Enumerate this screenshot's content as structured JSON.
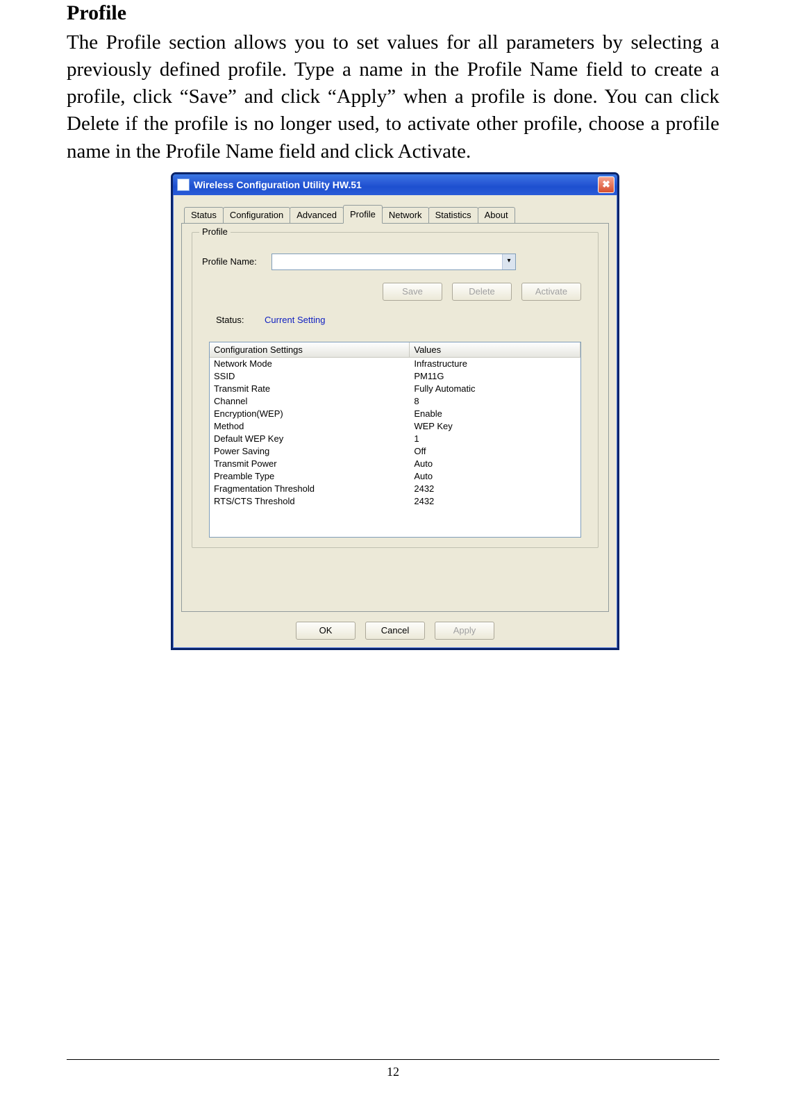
{
  "doc": {
    "heading": "Profile",
    "body": "The Profile section allows you to set values for all parameters by selecting a previously defined profile. Type a name in the Profile Name field to create a profile, click “Save” and click “Apply” when a profile is done. You can click Delete if the profile is no longer used, to activate other profile, choose a profile name in the Profile Name field and click Activate.",
    "page_number": "12"
  },
  "window": {
    "title": "Wireless Configuration Utility HW.51",
    "close_glyph": "✖",
    "tabs": [
      "Status",
      "Configuration",
      "Advanced",
      "Profile",
      "Network",
      "Statistics",
      "About"
    ],
    "active_tab_index": 3,
    "groupbox_title": "Profile",
    "profile_name_label": "Profile Name:",
    "profile_name_value": "",
    "dropdown_glyph": "▾",
    "buttons": {
      "save": "Save",
      "delete": "Delete",
      "activate": "Activate",
      "ok": "OK",
      "cancel": "Cancel",
      "apply": "Apply"
    },
    "status_label": "Status:",
    "status_value": "Current Setting",
    "list_header": {
      "col1": "Configuration Settings",
      "col2": "Values"
    },
    "list_rows": [
      {
        "setting": "Network Mode",
        "value": "Infrastructure"
      },
      {
        "setting": "SSID",
        "value": "PM11G"
      },
      {
        "setting": "Transmit Rate",
        "value": "Fully Automatic"
      },
      {
        "setting": "Channel",
        "value": "8"
      },
      {
        "setting": "Encryption(WEP)",
        "value": "Enable"
      },
      {
        "setting": "Method",
        "value": "WEP Key"
      },
      {
        "setting": "Default WEP Key",
        "value": "1"
      },
      {
        "setting": "Power Saving",
        "value": "Off"
      },
      {
        "setting": "Transmit Power",
        "value": "Auto"
      },
      {
        "setting": "Preamble Type",
        "value": "Auto"
      },
      {
        "setting": "Fragmentation Threshold",
        "value": "2432"
      },
      {
        "setting": "RTS/CTS Threshold",
        "value": "2432"
      }
    ]
  }
}
